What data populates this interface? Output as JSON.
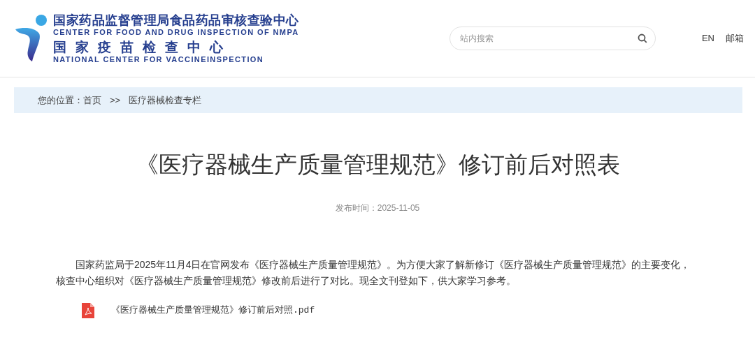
{
  "header": {
    "logo": {
      "title_cn": "国家药品监督管理局食品药品审核查验中心",
      "title_en": "CENTER FOR FOOD AND DRUG INSPECTION OF NMPA",
      "subtitle_cn": "国家疫苗检查中心",
      "subtitle_en": "NATIONAL CENTER FOR VACCINEINSPECTION"
    },
    "search": {
      "placeholder": "站内搜索"
    },
    "links": [
      "EN",
      "邮箱"
    ]
  },
  "breadcrumb": {
    "label": "您的位置：",
    "items": [
      {
        "text": "首页",
        "kind": "link"
      },
      {
        "text": ">>",
        "kind": "separator"
      },
      {
        "text": "医疗器械检查专栏",
        "kind": "link"
      }
    ]
  },
  "article": {
    "title": "《医疗器械生产质量管理规范》修订前后对照表",
    "date_label": "发布时间：",
    "date": "2025-11-05",
    "paragraph": "国家药监局于2025年11月4日在官网发布《医疗器械生产质量管理规范》。为方便大家了解新修订《医疗器械生产质量管理规范》的主要变化，核查中心组织对《医疗器械生产质量管理规范》修改前后进行了对比。现全文刊登如下，供大家学习参考。",
    "attachments": [
      {
        "name": "《医疗器械生产质量管理规范》修订前后对照.pdf"
      }
    ]
  }
}
